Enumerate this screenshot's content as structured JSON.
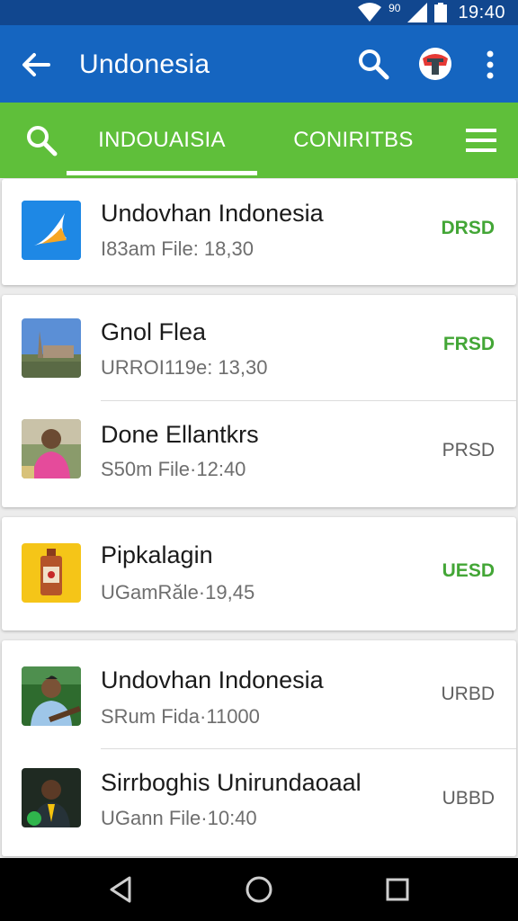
{
  "status_bar": {
    "time": "19:40",
    "signal_label": "90",
    "icons": [
      "wifi-icon",
      "cell-signal-icon",
      "battery-icon"
    ]
  },
  "app_bar": {
    "title": "Undonesia",
    "icons": [
      "back-arrow-icon",
      "search-icon",
      "avatar-icon",
      "more-vert-icon"
    ]
  },
  "tabs": {
    "items": [
      {
        "label": "INDOUAISIA",
        "active": true
      },
      {
        "label": "CONIRITBS"
      }
    ],
    "icons": [
      "search-icon",
      "menu-icon"
    ]
  },
  "lists": [
    {
      "rows": [
        {
          "title": "Undovhan Indonesia",
          "meta": "I83am File: 18,30",
          "badge": "DRSD",
          "badge_color": "#43a636",
          "thumb": "app-logo-blue"
        }
      ]
    },
    {
      "rows": [
        {
          "title": "Gnol Flea",
          "meta": "URROI119e: 13,30",
          "badge": "FRSD",
          "badge_color": "#43a636",
          "thumb": "landscape-photo"
        },
        {
          "title": "Done Ellantkrs",
          "meta": "S50m File·12:40",
          "badge": "PRSD",
          "badge_color": "#5f5f5f",
          "thumb": "person-pink-photo"
        }
      ]
    },
    {
      "rows": [
        {
          "title": "Pipkalagin",
          "meta": "UGamRăle·19,45",
          "badge": "UESD",
          "badge_color": "#43a636",
          "thumb": "bottle-yellow"
        }
      ]
    },
    {
      "rows": [
        {
          "title": "Undovhan Indonesia",
          "meta": "SRum Fida·11000",
          "badge": "URBD",
          "badge_color": "#5f5f5f",
          "thumb": "person-blue-photo"
        },
        {
          "title": "Sirrboghis Unirundaoaal",
          "meta": "UGann File·10:40",
          "badge": "UBBD",
          "badge_color": "#5f5f5f",
          "thumb": "person-dark-photo"
        }
      ]
    }
  ],
  "nav_bar": {
    "icons": [
      "back-triangle-icon",
      "home-circle-icon",
      "recents-square-icon"
    ]
  }
}
